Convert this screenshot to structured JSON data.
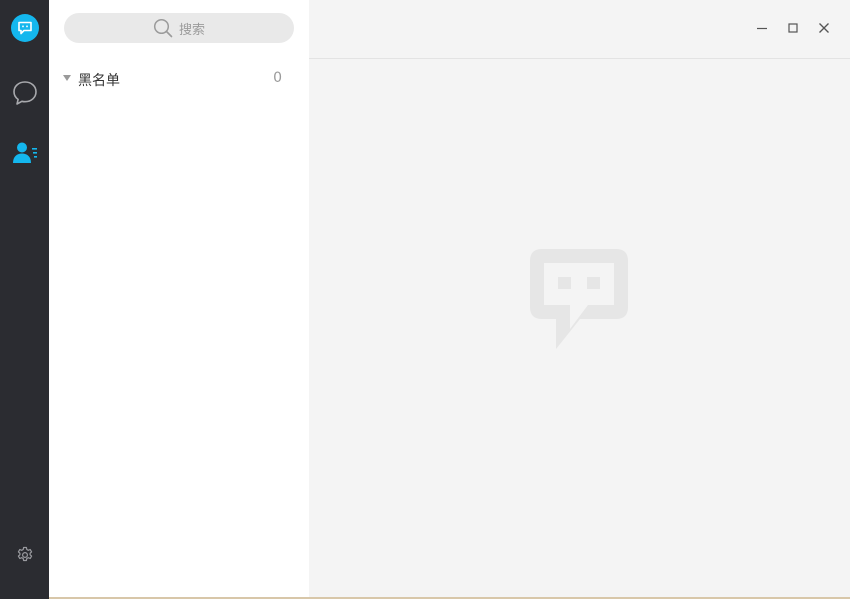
{
  "sidebar": {
    "items": [
      {
        "icon": "app-logo-icon",
        "active": false
      },
      {
        "icon": "chat-bubble-icon",
        "active": false
      },
      {
        "icon": "contacts-icon",
        "active": true
      },
      {
        "icon": "gear-icon",
        "active": false
      }
    ]
  },
  "search": {
    "placeholder": "搜索",
    "icon": "search-icon"
  },
  "contacts": {
    "groups": [
      {
        "name": "黑名单",
        "count": "0",
        "expanded": true
      }
    ]
  },
  "window_controls": {
    "minimize": "minimize-icon",
    "maximize": "maximize-icon",
    "close": "close-icon"
  },
  "colors": {
    "nav_bg": "#2b2c31",
    "accent": "#14b7ee",
    "panel_bg": "#ffffff",
    "main_bg": "#f4f4f4",
    "placeholder_logo": "#e6e6e6"
  }
}
